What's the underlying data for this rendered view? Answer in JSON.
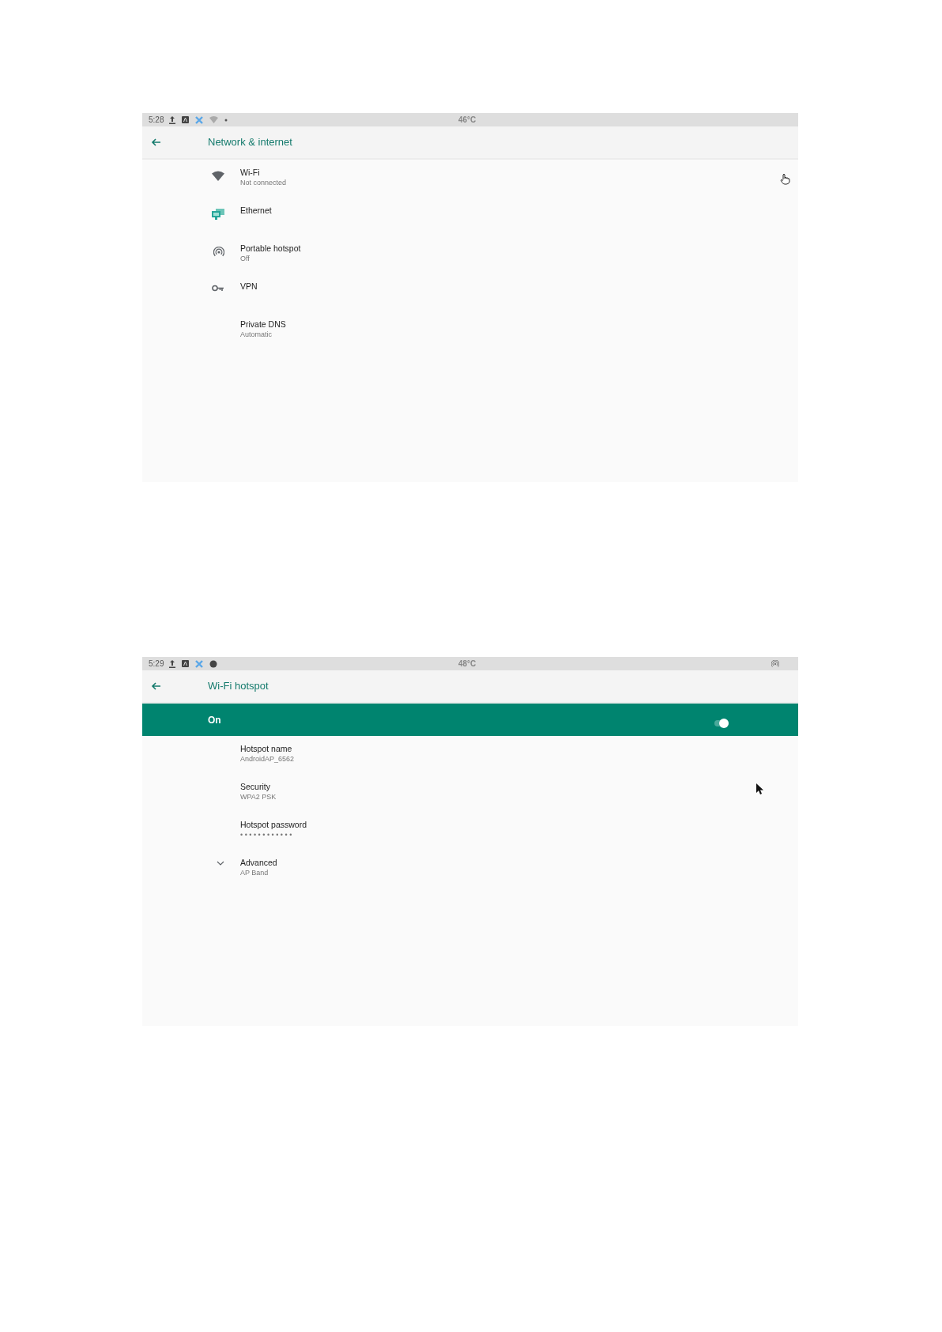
{
  "screens": [
    {
      "status_bar": {
        "time": "5:28",
        "temperature": "46°C",
        "notifications": [
          {
            "kind": "upload"
          },
          {
            "kind": "letter-box"
          },
          {
            "kind": "cross"
          },
          {
            "kind": "wifi"
          },
          {
            "kind": "dot"
          }
        ]
      },
      "title": "Network & internet",
      "items": [
        {
          "kind": "wifi",
          "title": "Wi-Fi",
          "subtitle": "Not connected"
        },
        {
          "kind": "ethernet",
          "title": "Ethernet"
        },
        {
          "kind": "hotspot",
          "title": "Portable hotspot",
          "subtitle": "Off"
        },
        {
          "kind": "vpn",
          "title": "VPN"
        },
        {
          "kind": "plain",
          "title": "Private DNS",
          "subtitle": "Automatic"
        }
      ],
      "pointer": {
        "kind": "hand"
      }
    },
    {
      "status_bar": {
        "time": "5:29",
        "temperature": "48°C",
        "notifications": [
          {
            "kind": "upload"
          },
          {
            "kind": "letter-box"
          },
          {
            "kind": "cross"
          },
          {
            "kind": "circle"
          }
        ],
        "right_icons": [
          {
            "kind": "hotspot"
          }
        ]
      },
      "title": "Wi-Fi hotspot",
      "toggle": {
        "label": "On",
        "on": true
      },
      "items": [
        {
          "kind": "plain",
          "title": "Hotspot name",
          "subtitle": "AndroidAP_6562"
        },
        {
          "kind": "plain",
          "title": "Security",
          "subtitle": "WPA2 PSK"
        },
        {
          "kind": "plain",
          "title": "Hotspot password",
          "subtitle": "• • • • • • • • • • • •"
        },
        {
          "kind": "expandable",
          "title": "Advanced",
          "subtitle": "AP Band",
          "expanded": false
        }
      ],
      "pointer": {
        "kind": "arrow"
      }
    }
  ]
}
